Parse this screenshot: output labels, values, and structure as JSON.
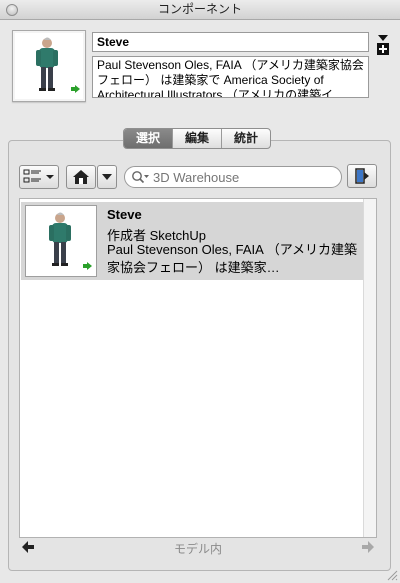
{
  "window": {
    "title": "コンポーネント"
  },
  "component": {
    "name": "Steve",
    "description": "Paul Stevenson Oles, FAIA （アメリカ建築家協会フェロー） は建築家で America Society of Architectural Illustrators （アメリカの建築イ"
  },
  "tabs": [
    {
      "label": "選択",
      "active": true
    },
    {
      "label": "編集",
      "active": false
    },
    {
      "label": "統計",
      "active": false
    }
  ],
  "search": {
    "placeholder": "3D Warehouse"
  },
  "results": [
    {
      "title": "Steve",
      "author": "作成者 SketchUp",
      "description": "Paul Stevenson Oles, FAIA （アメリカ建築家協会フェロー） は建築家…"
    }
  ],
  "footer": {
    "label": "モデル内"
  },
  "icons": {
    "close": "close-dot-icon",
    "detail_toggle": "details-toggle-icon",
    "view_options": "view-options-icon",
    "home": "home-icon",
    "navigation": "chevron-down-icon",
    "search": "search-icon",
    "secondary_pane": "secondary-pane-icon",
    "back": "back-arrow-icon",
    "forward": "forward-arrow-icon"
  },
  "colors": {
    "selected_row": "#d6d6d6",
    "active_tab": "#7c7c7c",
    "component_badge": "#2aa02a"
  }
}
